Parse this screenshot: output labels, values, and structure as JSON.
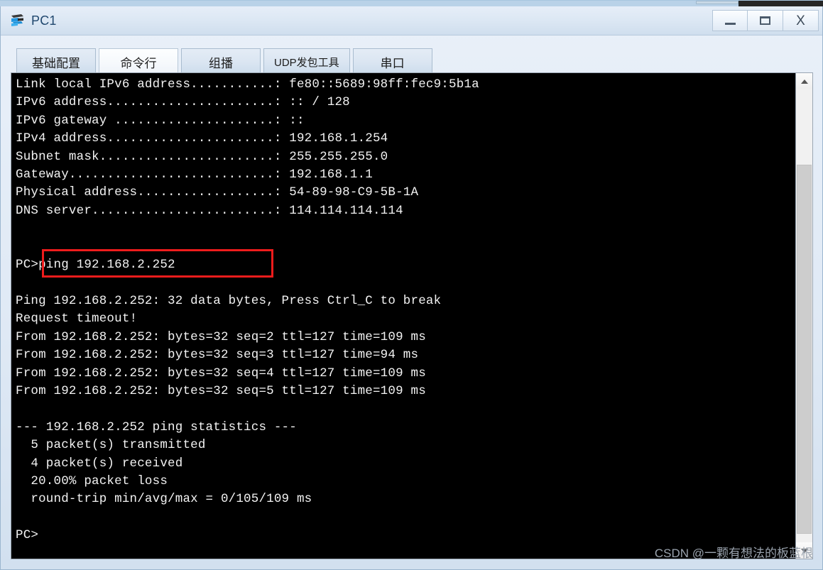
{
  "window": {
    "title": "PC1",
    "icon": "device-pc-icon",
    "controls": {
      "minimize": "_",
      "maximize": "□",
      "close": "X"
    }
  },
  "tabs": [
    {
      "label": "基础配置",
      "active": false
    },
    {
      "label": "命令行",
      "active": true
    },
    {
      "label": "组播",
      "active": false
    },
    {
      "label": "UDP发包工具",
      "active": false,
      "small": true
    },
    {
      "label": "串口",
      "active": false
    }
  ],
  "terminal": {
    "prompt": "PC>",
    "lines": [
      "Link local IPv6 address...........: fe80::5689:98ff:fec9:5b1a",
      "IPv6 address......................: :: / 128",
      "IPv6 gateway .....................: ::",
      "IPv4 address......................: 192.168.1.254",
      "Subnet mask.......................: 255.255.255.0",
      "Gateway...........................: 192.168.1.1",
      "Physical address..................: 54-89-98-C9-5B-1A",
      "DNS server........................: 114.114.114.114",
      "",
      "",
      "PC>ping 192.168.2.252",
      "",
      "Ping 192.168.2.252: 32 data bytes, Press Ctrl_C to break",
      "Request timeout!",
      "From 192.168.2.252: bytes=32 seq=2 ttl=127 time=109 ms",
      "From 192.168.2.252: bytes=32 seq=3 ttl=127 time=94 ms",
      "From 192.168.2.252: bytes=32 seq=4 ttl=127 time=109 ms",
      "From 192.168.2.252: bytes=32 seq=5 ttl=127 time=109 ms",
      "",
      "--- 192.168.2.252 ping statistics ---",
      "  5 packet(s) transmitted",
      "  4 packet(s) received",
      "  20.00% packet loss",
      "  round-trip min/avg/max = 0/105/109 ms",
      "",
      "PC>"
    ],
    "network_info": {
      "link_local_ipv6": "fe80::5689:98ff:fec9:5b1a",
      "ipv6_address": ":: / 128",
      "ipv6_gateway": "::",
      "ipv4_address": "192.168.1.254",
      "subnet_mask": "255.255.255.0",
      "gateway": "192.168.1.1",
      "physical_address": "54-89-98-C9-5B-1A",
      "dns_server": "114.114.114.114"
    },
    "ping": {
      "command": "ping 192.168.2.252",
      "target": "192.168.2.252",
      "data_bytes": "32",
      "transmitted": "5",
      "received": "4",
      "packet_loss": "20.00%",
      "round_trip": "0/105/109 ms"
    }
  },
  "annotation": {
    "type": "red-rectangle",
    "color": "#ee1c1c",
    "highlights": "ping 192.168.2.252"
  },
  "scrollbar": {
    "up_arrow": "▲",
    "down_arrow": "▼"
  },
  "watermark": {
    "text": "CSDN @一颗有想法的板蓝根"
  }
}
